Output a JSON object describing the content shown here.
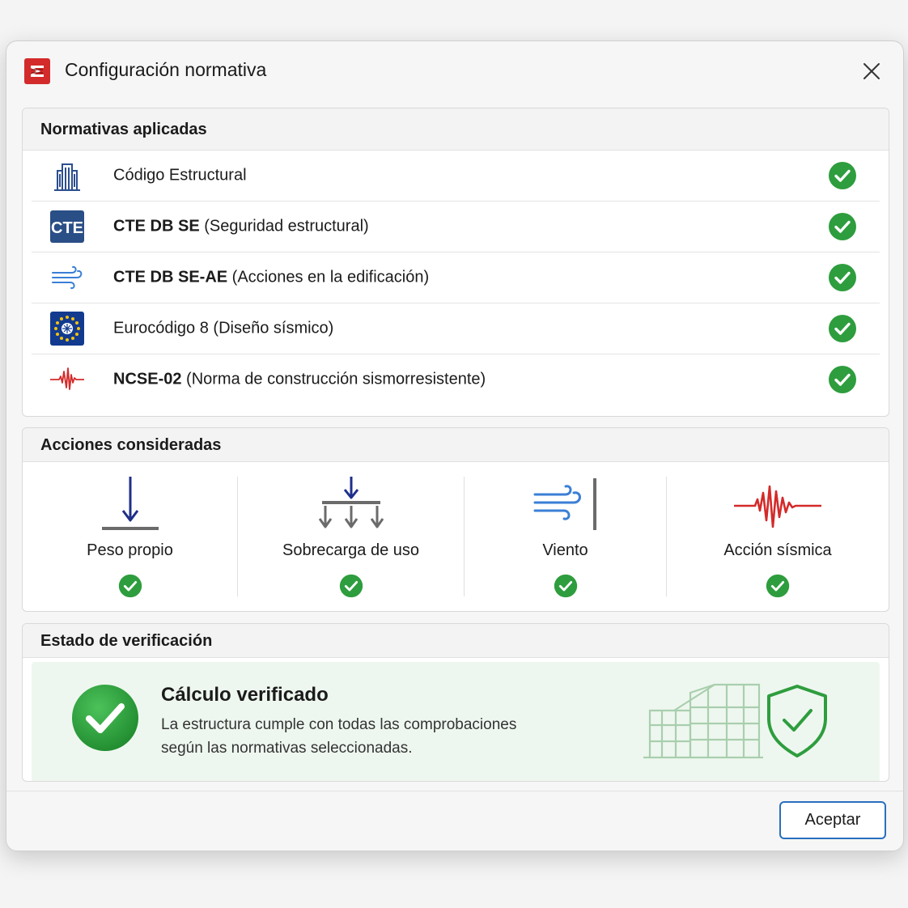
{
  "window": {
    "title": "Configuración normativa"
  },
  "normativas": {
    "header": "Normativas aplicadas",
    "items": [
      {
        "bold": "",
        "text": "Código Estructural",
        "icon": "building-icon",
        "status": "verified"
      },
      {
        "bold": "CTE DB SE",
        "text": " (Seguridad estructural)",
        "icon": "cte-icon",
        "status": "verified"
      },
      {
        "bold": "CTE DB SE-AE",
        "text": " (Acciones en la edificación)",
        "icon": "wind-icon",
        "status": "verified"
      },
      {
        "bold": "",
        "text": "Eurocódigo 8 (Diseño sísmico)",
        "icon": "eu-flag-icon",
        "status": "verified"
      },
      {
        "bold": "NCSE-02",
        "text": " (Norma de construcción sismorresistente)",
        "icon": "seismic-wave-icon",
        "status": "verified"
      }
    ],
    "cte_badge": "CTE"
  },
  "acciones": {
    "header": "Acciones consideradas",
    "items": [
      {
        "label": "Peso propio",
        "icon": "dead-load-icon",
        "status": "verified"
      },
      {
        "label": "Sobrecarga de uso",
        "icon": "live-load-icon",
        "status": "verified"
      },
      {
        "label": "Viento",
        "icon": "wind-load-icon",
        "status": "verified"
      },
      {
        "label": "Acción sísmica",
        "icon": "seismic-action-icon",
        "status": "verified"
      }
    ]
  },
  "estado": {
    "header": "Estado de verificación",
    "title": "Cálculo verificado",
    "line1": "La estructura cumple con todas las comprobaciones",
    "line2": "según las normativas seleccionadas."
  },
  "footer": {
    "accept_label": "Aceptar"
  },
  "colors": {
    "accent": "#2a6fbe",
    "success": "#2e9d3e",
    "navy": "#1f2f8a",
    "seismic": "#d42a2a"
  }
}
